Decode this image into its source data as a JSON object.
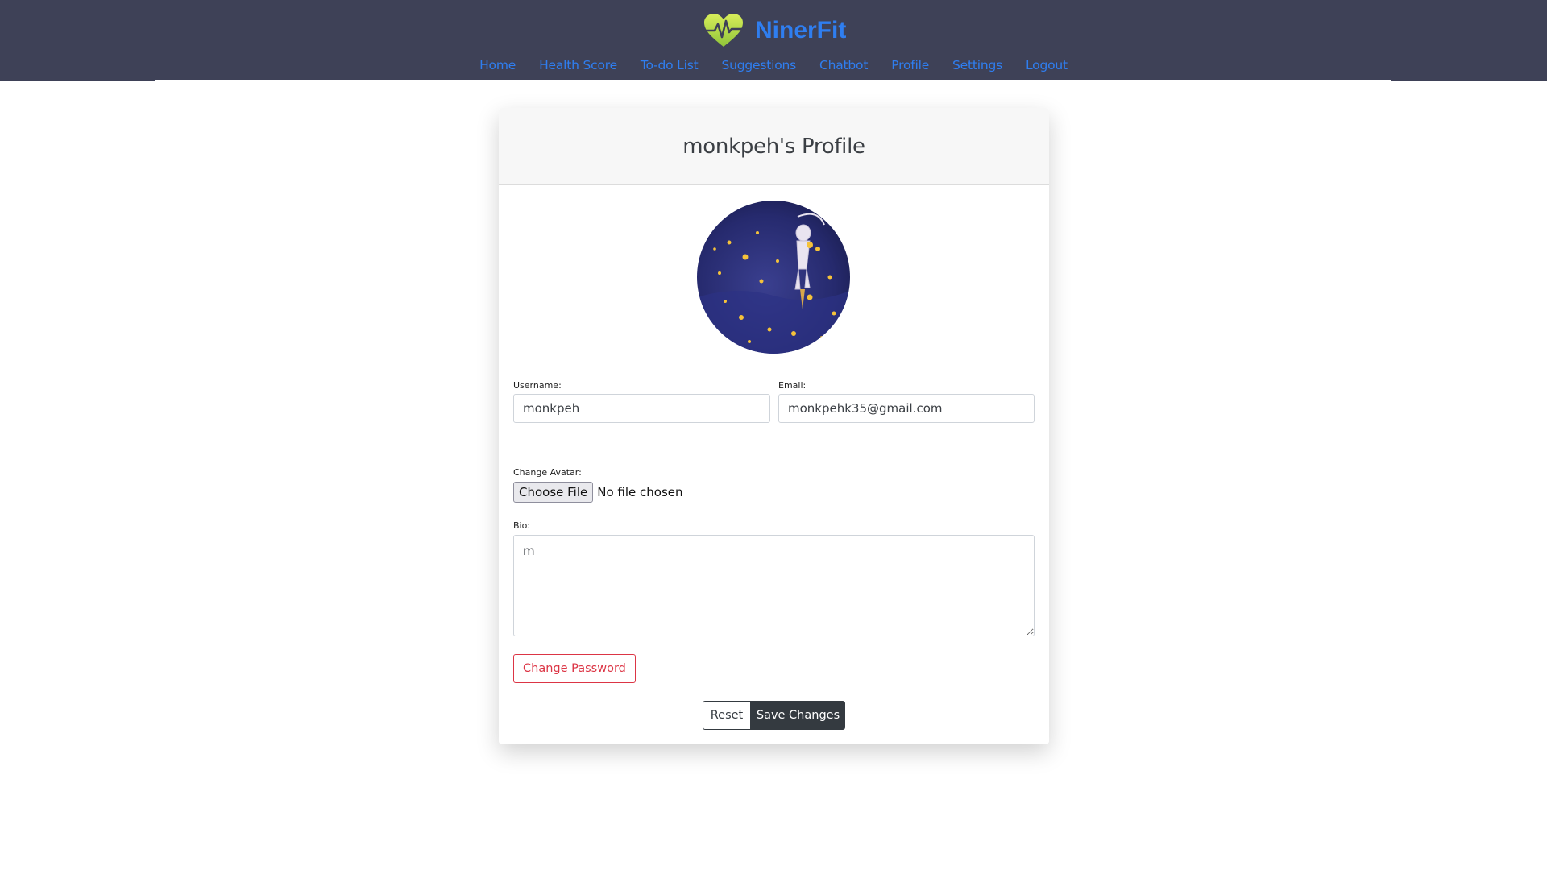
{
  "brand": {
    "name": "NinerFit",
    "logo_icon": "heart-pulse-icon",
    "color": "#2f7ef0"
  },
  "nav": {
    "items": [
      {
        "label": "Home"
      },
      {
        "label": "Health Score"
      },
      {
        "label": "To-do List"
      },
      {
        "label": "Suggestions"
      },
      {
        "label": "Chatbot"
      },
      {
        "label": "Profile"
      },
      {
        "label": "Settings"
      },
      {
        "label": "Logout"
      }
    ]
  },
  "profile": {
    "title": "monkpeh's Profile",
    "avatar_icon": "avatar-image",
    "username_label": "Username:",
    "username_value": "monkpeh",
    "email_label": "Email:",
    "email_value": "monkpehk35@gmail.com",
    "avatar_label": "Change Avatar:",
    "choose_file_label": "Choose File",
    "file_status": "No file chosen",
    "bio_label": "Bio:",
    "bio_value": "m",
    "change_password_label": "Change Password",
    "reset_label": "Reset",
    "save_label": "Save Changes"
  },
  "colors": {
    "header_bg": "#3e4157",
    "link": "#2f7ef0",
    "danger": "#dc3545",
    "dark": "#343a40"
  }
}
